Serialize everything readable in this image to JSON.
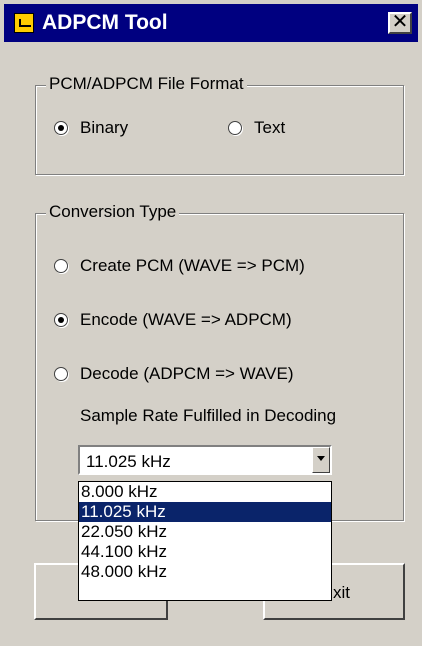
{
  "window": {
    "title": "ADPCM Tool",
    "close_glyph": "✕"
  },
  "file_format": {
    "label": "PCM/ADPCM File Format",
    "options": [
      {
        "label": "Binary",
        "checked": true
      },
      {
        "label": "Text",
        "checked": false
      }
    ]
  },
  "conversion": {
    "label": "Conversion Type",
    "options": [
      {
        "label": "Create PCM  (WAVE => PCM)",
        "checked": false
      },
      {
        "label": "Encode  (WAVE => ADPCM)",
        "checked": true
      },
      {
        "label": "Decode  (ADPCM => WAVE)",
        "checked": false
      }
    ],
    "sample_rate_label": "Sample Rate Fulfilled in Decoding",
    "sample_rate_value": "11.025 kHz",
    "sample_rate_options": [
      "8.000 kHz",
      "11.025 kHz",
      "22.050 kHz",
      "44.100 kHz",
      "48.000 kHz"
    ]
  },
  "buttons": {
    "exit_label_visible": "xit"
  },
  "colors": {
    "title_bg": "#000080",
    "selected_bg": "#0a246a",
    "face": "#d4d0c8"
  }
}
